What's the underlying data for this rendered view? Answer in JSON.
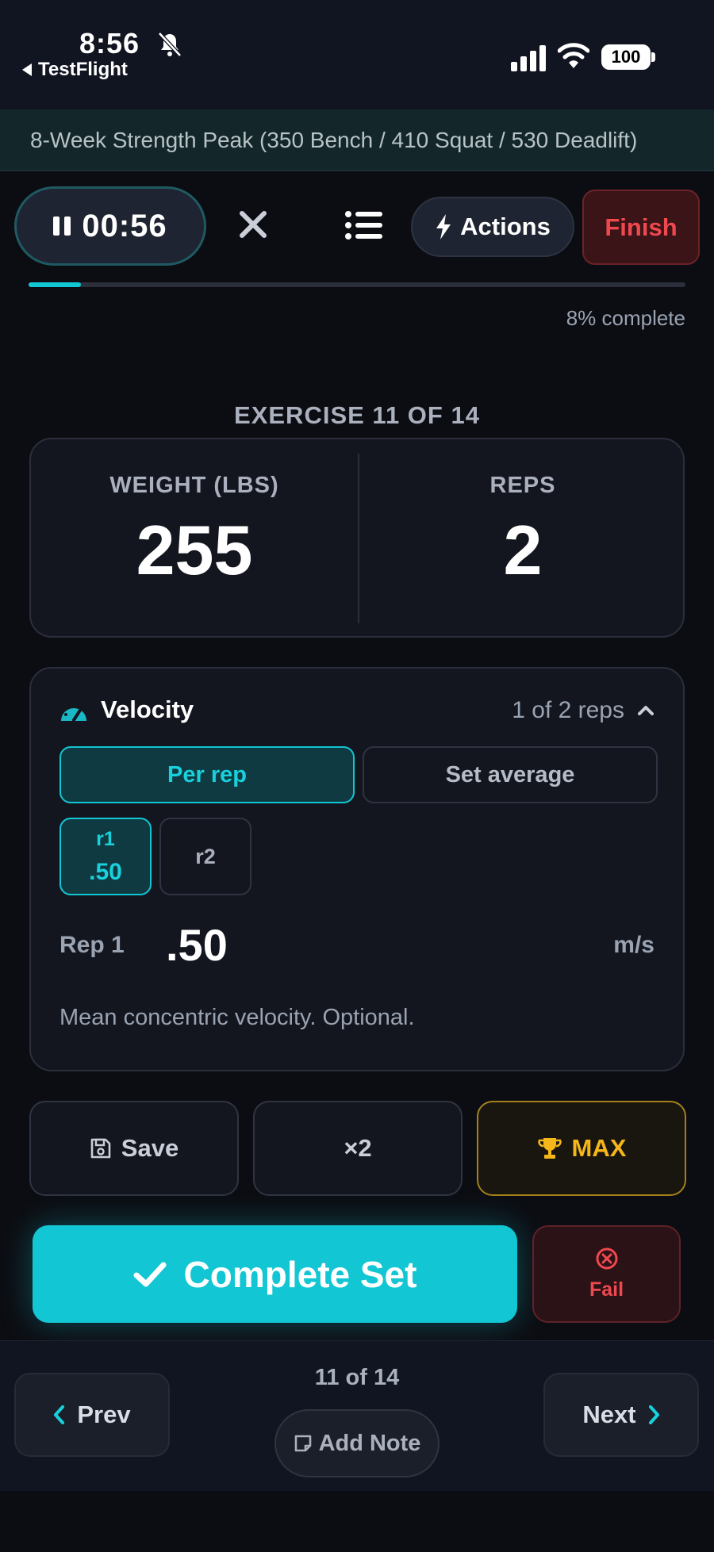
{
  "status_bar": {
    "time": "8:56",
    "back_app": "TestFlight",
    "battery": "100"
  },
  "program": {
    "title": "8-Week Strength Peak (350 Bench / 410 Squat / 530 Deadlift)"
  },
  "toolbar": {
    "timer": "00:56",
    "actions_label": "Actions",
    "finish_label": "Finish"
  },
  "progress": {
    "fraction": 0.08,
    "label": "8% complete"
  },
  "exercise": {
    "label": "EXERCISE 11 OF 14",
    "weight_caption": "WEIGHT (LBS)",
    "weight_value": "255",
    "reps_caption": "REPS",
    "reps_value": "2"
  },
  "velocity": {
    "title": "Velocity",
    "count": "1 of 2 reps",
    "mode_per_rep": "Per rep",
    "mode_set_average": "Set average",
    "chips": [
      {
        "label": "r1",
        "value": ".50"
      },
      {
        "label": "r2",
        "value": ""
      }
    ],
    "rep_label": "Rep 1",
    "rep_value": ".50",
    "unit": "m/s",
    "hint": "Mean concentric velocity. Optional."
  },
  "set_actions": {
    "save_label": "Save",
    "multiplier_label": "×2",
    "max_label": "MAX"
  },
  "primary": {
    "complete_label": "Complete Set",
    "fail_label": "Fail"
  },
  "nav": {
    "prev_label": "Prev",
    "next_label": "Next",
    "position": "11 of 14",
    "add_note_label": "Add Note"
  },
  "colors": {
    "accent": "#12c6d3",
    "danger": "#f0484f",
    "gold": "#f5b61a",
    "background": "#0c0d12"
  },
  "icons": [
    "bell-slash-icon",
    "signal-icon",
    "wifi-icon",
    "pause-icon",
    "close-icon",
    "list-icon",
    "bolt-icon",
    "gauge-icon",
    "chevron-up-icon",
    "floppy-disk-icon",
    "trophy-icon",
    "checkmark-icon",
    "x-circle-icon",
    "chevron-left-icon",
    "chevron-right-icon",
    "note-icon"
  ]
}
